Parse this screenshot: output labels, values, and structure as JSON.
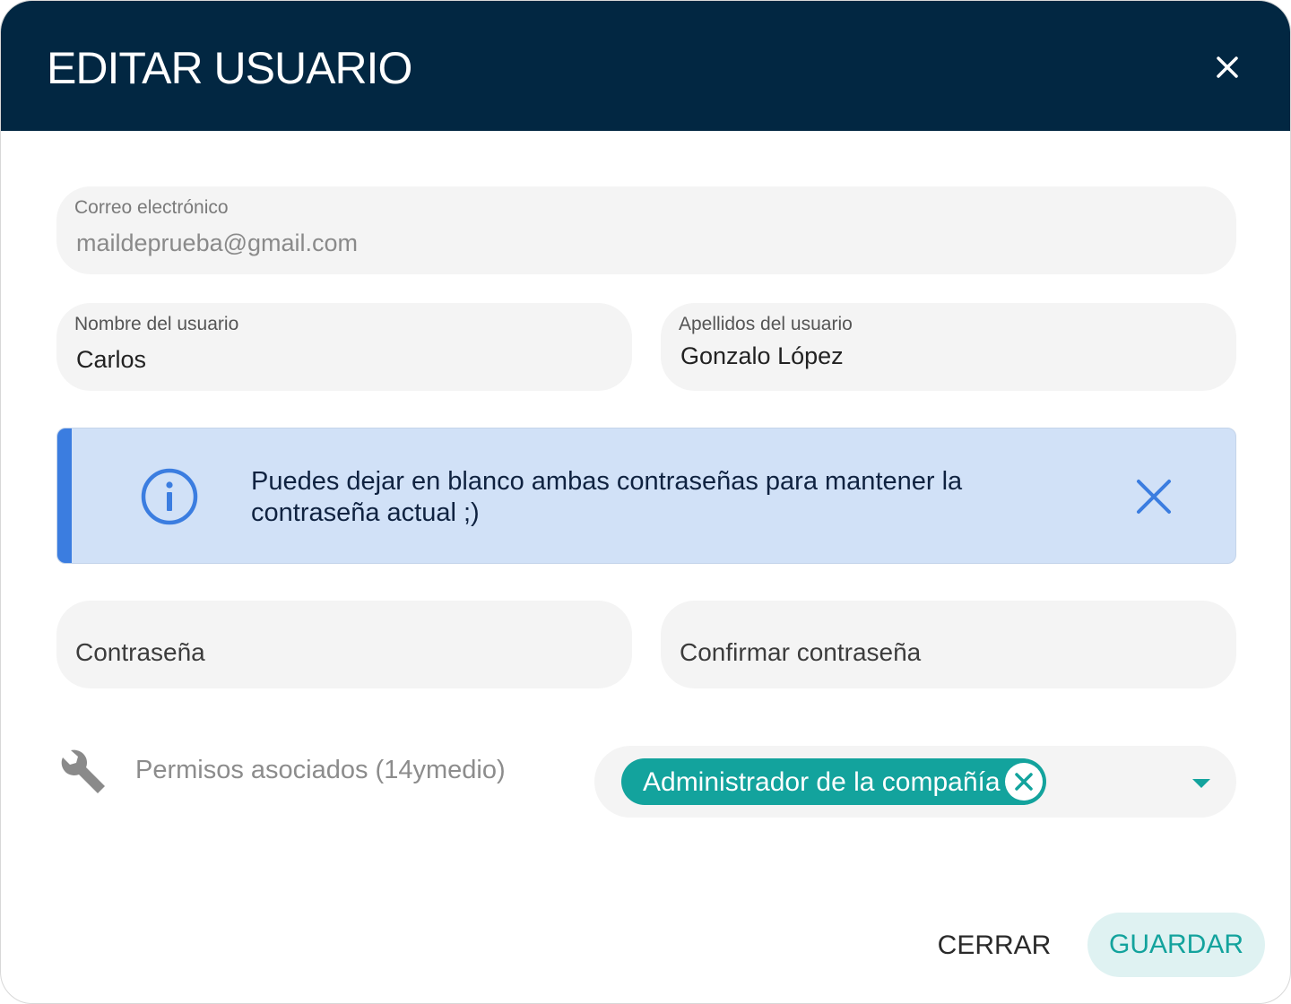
{
  "dialog": {
    "title": "EDITAR USUARIO"
  },
  "form": {
    "email": {
      "label": "Correo electrónico",
      "value": "maildeprueba@gmail.com"
    },
    "first_name": {
      "label": "Nombre del usuario",
      "value": "Carlos"
    },
    "last_name": {
      "label": "Apellidos del usuario",
      "value": "Gonzalo López"
    },
    "password": {
      "placeholder": "Contraseña"
    },
    "confirm_password": {
      "placeholder": "Confirmar contraseña"
    }
  },
  "alert": {
    "message": "Puedes dejar en blanco ambas contraseñas para mantener la contraseña actual ;)",
    "icon": "info-icon"
  },
  "permissions": {
    "label": "Permisos asociados (14ymedio)",
    "icon": "wrench-icon",
    "selected": [
      "Administrador de la compañía"
    ]
  },
  "actions": {
    "close_label": "CERRAR",
    "save_label": "GUARDAR"
  },
  "colors": {
    "header_bg": "#022742",
    "accent": "#13a39d",
    "alert_bg": "#d1e1f7",
    "alert_accent": "#3b7de0",
    "field_bg": "#f4f4f4"
  }
}
